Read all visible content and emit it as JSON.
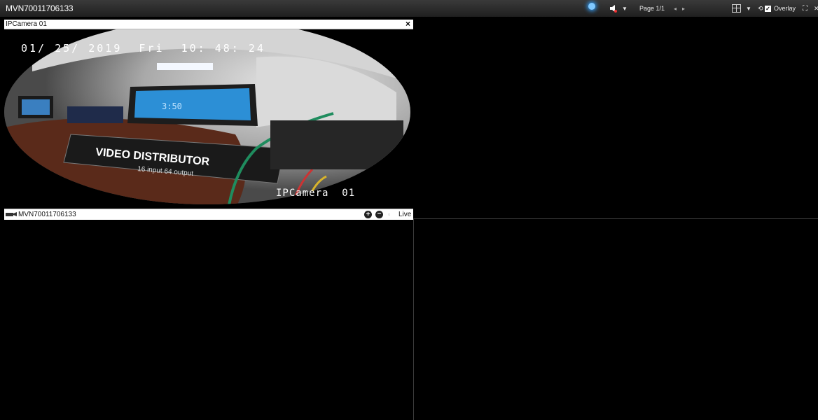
{
  "toolbar": {
    "device_title": "MVN70011706133",
    "page_label": "Page 1/1",
    "prev_glyph": "◂",
    "next_glyph": "▸",
    "overlay_label": "Overlay",
    "icons": [
      "brightness-icon",
      "speaker-icon",
      "layout-grid-icon",
      "cycle-icon",
      "fullscreen-icon",
      "close-icon"
    ]
  },
  "pane1": {
    "title": "IPCamera 01",
    "close_glyph": "×",
    "video": {
      "timestamp": "01/ 25/ 2019  Fri  10: 48: 24",
      "camera_overlay": "IPCamera  01",
      "distributor_text": "VIDEO DISTRIBUTOR",
      "distributor_subtext": "16 input 64 output",
      "monitor_text": "3:50"
    },
    "status": {
      "device": "MVN70011706133",
      "zoom_in_glyph": "+",
      "zoom_out_glyph": "−",
      "mode": "Live"
    }
  },
  "colors": {
    "toolbar_bg": "#2a2a2a",
    "grid_bg": "#000000",
    "accent_blue": "#2f8fe0"
  }
}
